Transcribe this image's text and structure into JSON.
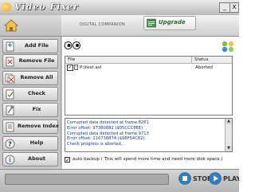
{
  "window": {
    "title": "Video Fixer",
    "minimize_glyph": "_",
    "close_glyph": "x"
  },
  "header": {
    "brand_text": "DIGITAL COMPANION",
    "upgrade_label": "Upgrade"
  },
  "sidebar": {
    "items": [
      {
        "label": "Add File",
        "icon": "add-file-icon"
      },
      {
        "label": "Remove File",
        "icon": "remove-file-icon"
      },
      {
        "label": "Remove All",
        "icon": "remove-all-icon"
      },
      {
        "label": "Check",
        "icon": "check-icon"
      },
      {
        "label": "Fix",
        "icon": "fix-icon"
      },
      {
        "label": "Remove Index",
        "icon": "remove-index-icon"
      },
      {
        "label": "Help",
        "icon": "help-icon"
      },
      {
        "label": "About",
        "icon": "about-icon"
      }
    ]
  },
  "file_table": {
    "columns": [
      "File",
      "Status"
    ],
    "rows": [
      {
        "file": "P:\\test.avi",
        "status": "Aborted",
        "checked": true
      }
    ]
  },
  "log": {
    "lines": [
      "Corrupted data detected at frame 8261",
      "Error offset: 97380882 ($05CCC8EE)",
      "Corrupted data detected at frame 9713",
      "Error offset: 116738874 ($06F54C82)",
      "Check progress is aborted..."
    ]
  },
  "backup": {
    "checked": true,
    "label": "auto backup   ( This will spend more time and need more disk space.)"
  },
  "controls": {
    "stop_label": "STOP",
    "play_label": "PLAY"
  },
  "progress": {
    "fraction": 0
  },
  "colors": {
    "stop_icon": "#2f7fc8",
    "play_icon": "#2f7fc8",
    "log_text": "#1a3a8a",
    "upgrade_text": "#2a6a2a"
  }
}
